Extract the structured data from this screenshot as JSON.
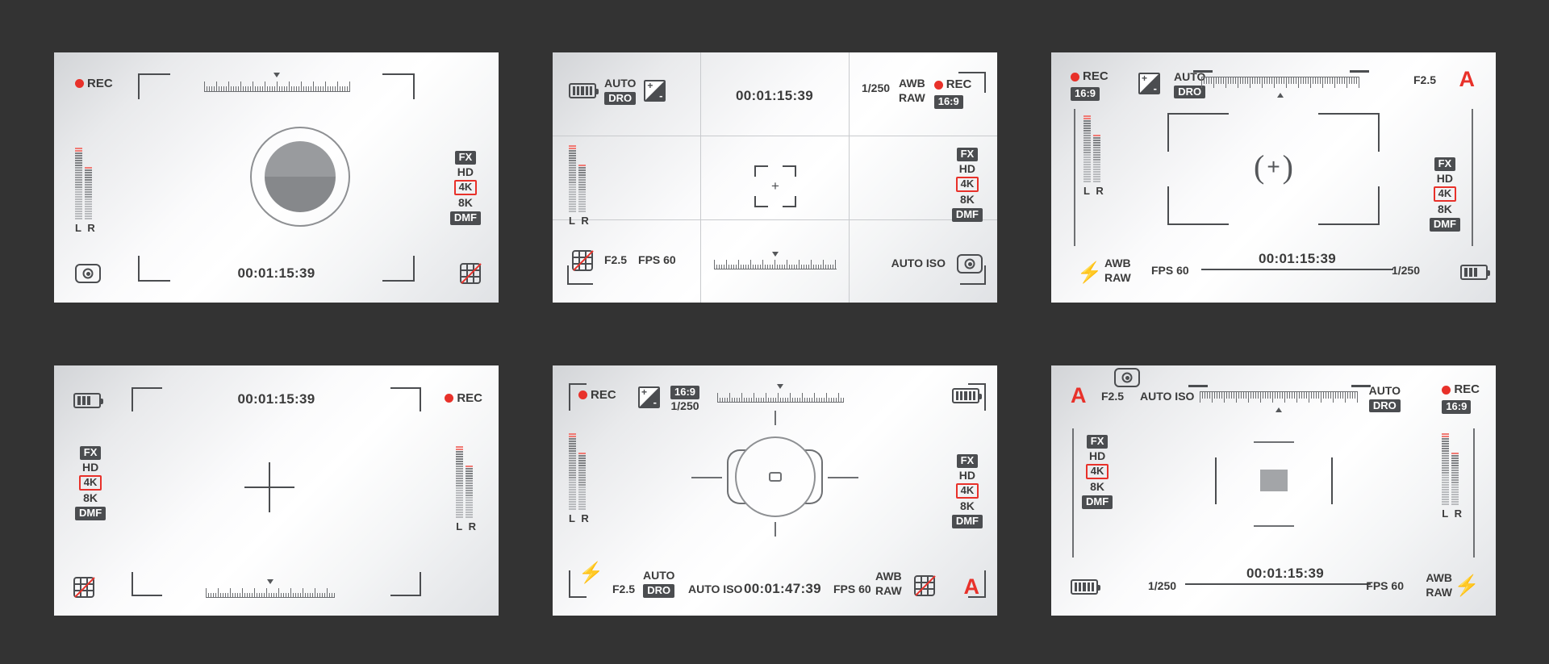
{
  "meta": {
    "background_color": "#333333",
    "panel_accent_red": "#e8312a",
    "panel_ink": "#3b3b3b",
    "panel_count": 6,
    "title": "Camera Viewfinder Frames Set"
  },
  "common": {
    "rec_label": "REC",
    "fx": "FX",
    "hd": "HD",
    "k4": "4K",
    "k8": "8K",
    "dmf": "DMF",
    "lr": "L R",
    "auto": "AUTO",
    "dro": "DRO",
    "awb": "AWB",
    "raw": "RAW",
    "auto_iso": "AUTO ISO",
    "fps": "FPS 60",
    "aperture": "F2.5",
    "shutter": "1/250",
    "ratio": "16:9",
    "a_mode": "A",
    "timecode": "00:01:15:39"
  },
  "panels": [
    {
      "id": "panel-1",
      "name": "viewfinder-classic-center-dot",
      "rec": "REC",
      "timecode": "00:01:15:39",
      "side_stack": [
        "FX",
        "HD",
        "4K",
        "8K",
        "DMF"
      ],
      "audio_label": "L R",
      "icons": [
        "battery-icon",
        "grid-off-icon",
        "metering-icon",
        "corner-bracket",
        "ruler-scale"
      ]
    },
    {
      "id": "panel-2",
      "name": "viewfinder-thirds-grid",
      "rec": "REC",
      "timecode": "00:01:15:39",
      "top_left": {
        "auto": "AUTO",
        "dro": "DRO"
      },
      "top_right": {
        "shutter": "1/250",
        "awb": "AWB",
        "raw": "RAW",
        "ratio": "16:9"
      },
      "side_stack": [
        "FX",
        "HD",
        "4K",
        "8K",
        "DMF"
      ],
      "bottom_left": {
        "aperture": "F2.5",
        "fps": "FPS 60"
      },
      "bottom_right": {
        "auto_iso": "AUTO ISO"
      },
      "audio_label": "L R"
    },
    {
      "id": "panel-3",
      "name": "viewfinder-wide-bracket",
      "rec": "REC",
      "ratio": "16:9",
      "auto": "AUTO",
      "dro": "DRO",
      "aperture": "F2.5",
      "a_mode": "A",
      "side_stack": [
        "FX",
        "HD",
        "4K",
        "8K",
        "DMF"
      ],
      "audio_label": "L R",
      "bottom": {
        "awb": "AWB",
        "raw": "RAW",
        "fps": "FPS 60",
        "timecode": "00:01:15:39",
        "shutter": "1/250"
      }
    },
    {
      "id": "panel-4",
      "name": "viewfinder-minimal-crosshair",
      "rec": "REC",
      "timecode": "00:01:15:39",
      "side_stack": [
        "FX",
        "HD",
        "4K",
        "8K",
        "DMF"
      ],
      "audio_label": "L R"
    },
    {
      "id": "panel-5",
      "name": "viewfinder-focus-ring",
      "rec": "REC",
      "ratio": "16:9",
      "shutter": "1/250",
      "side_stack": [
        "FX",
        "HD",
        "4K",
        "8K",
        "DMF"
      ],
      "audio_label": "L R",
      "bottom": {
        "aperture": "F2.5",
        "auto": "AUTO",
        "dro": "DRO",
        "auto_iso": "AUTO ISO",
        "timecode": "00:01:47:39",
        "fps": "FPS 60",
        "awb": "AWB",
        "raw": "RAW",
        "a_mode": "A"
      }
    },
    {
      "id": "panel-6",
      "name": "viewfinder-spot-meter",
      "a_mode": "A",
      "aperture": "F2.5",
      "auto_iso": "AUTO ISO",
      "auto": "AUTO",
      "dro": "DRO",
      "rec": "REC",
      "ratio": "16:9",
      "side_stack": [
        "FX",
        "HD",
        "4K",
        "8K",
        "DMF"
      ],
      "audio_label": "L R",
      "bottom": {
        "shutter": "1/250",
        "timecode": "00:01:15:39",
        "fps": "FPS 60",
        "awb": "AWB",
        "raw": "RAW"
      }
    }
  ]
}
